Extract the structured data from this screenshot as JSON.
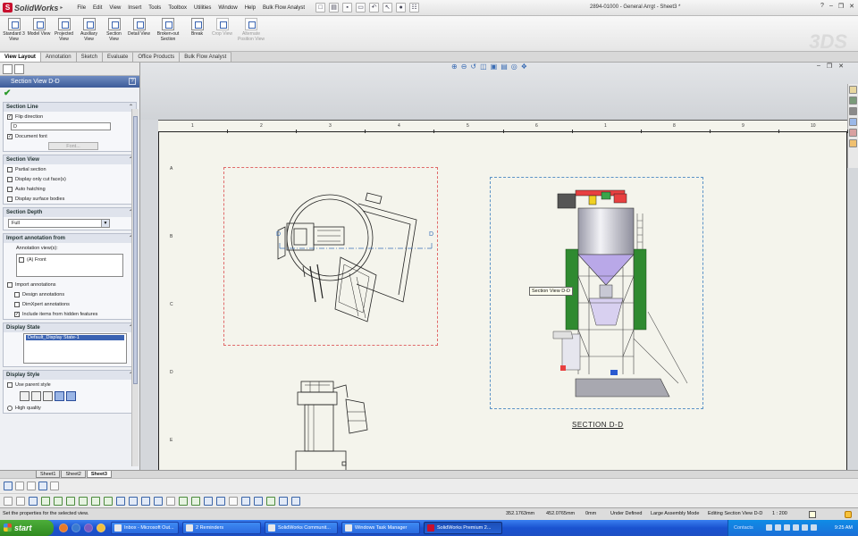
{
  "app": {
    "logo": "SolidWorks",
    "menu": [
      "File",
      "Edit",
      "View",
      "Insert",
      "Tools",
      "Toolbox",
      "Utilities",
      "Window",
      "Help",
      "Bulk Flow Analyst"
    ],
    "document_title": "2894-01000 - General Arrgt - Sheet3 *"
  },
  "command_manager": [
    {
      "label": "Standard 3 View",
      "icon": "standard-3-view-icon",
      "enabled": true
    },
    {
      "label": "Model View",
      "icon": "model-view-icon",
      "enabled": true
    },
    {
      "label": "Projected View",
      "icon": "projected-view-icon",
      "enabled": true
    },
    {
      "label": "Auxiliary View",
      "icon": "auxiliary-view-icon",
      "enabled": true
    },
    {
      "label": "Section View",
      "icon": "section-view-icon",
      "enabled": true
    },
    {
      "label": "Detail View",
      "icon": "detail-view-icon",
      "enabled": true
    },
    {
      "label": "Broken-out Section",
      "icon": "broken-out-section-icon",
      "enabled": true
    },
    {
      "label": "Break",
      "icon": "break-icon",
      "enabled": true
    },
    {
      "label": "Crop View",
      "icon": "crop-view-icon",
      "enabled": false
    },
    {
      "label": "Alternate Position View",
      "icon": "alternate-position-view-icon",
      "enabled": false
    }
  ],
  "tabs": [
    "View Layout",
    "Annotation",
    "Sketch",
    "Evaluate",
    "Office Products",
    "Bulk Flow Analyst"
  ],
  "active_tab": "View Layout",
  "property_manager": {
    "title": "Section View D-D",
    "section_line": {
      "header": "Section Line",
      "flip_direction": "Flip direction",
      "label_value": "D",
      "document_font": "Document font",
      "font_button": "Font..."
    },
    "section_view": {
      "header": "Section View",
      "options": [
        "Partial section",
        "Display only cut face(s)",
        "Auto hatching",
        "Display surface bodies"
      ]
    },
    "section_depth": {
      "header": "Section Depth",
      "value": "Full"
    },
    "import_annotation": {
      "header": "Import annotation from",
      "views_label": "Annotation view(s):",
      "view_item": "(A) Front",
      "import_annotations": "Import annotations",
      "design_annotations": "Design annotations",
      "dimxpert_annotations": "DimXpert annotations",
      "include_hidden": "Include items from hidden features"
    },
    "display_state": {
      "header": "Display State",
      "item": "Default_Display State-1"
    },
    "display_style": {
      "header": "Display Style",
      "use_parent": "Use parent style",
      "high_quality": "High quality"
    }
  },
  "drawing": {
    "ruler_numbers": [
      "1",
      "2",
      "3",
      "4",
      "5",
      "6",
      "1",
      "8",
      "9",
      "10"
    ],
    "zone_letters": [
      "A",
      "B",
      "C",
      "D",
      "E"
    ],
    "section_marker": "D",
    "tooltip": "Section View D-D",
    "section_label": "SECTION D-D"
  },
  "sheet_tabs": [
    "Sheet1",
    "Sheet2",
    "Sheet3"
  ],
  "active_sheet": "Sheet3",
  "status_bar": {
    "message": "Set the properties for the selected view.",
    "x": "352.1763mm",
    "y": "452.0765mm",
    "z": "0mm",
    "definition": "Under Defined",
    "mode": "Large Assembly Mode",
    "editing": "Editing Section View D-D",
    "scale": "1 : 200"
  },
  "taskbar": {
    "start": "start",
    "tasks": [
      {
        "label": "Inbox - Microsoft Out...",
        "active": false
      },
      {
        "label": "2 Reminders",
        "active": false
      },
      {
        "label": "SolidWorks Communit...",
        "active": false
      },
      {
        "label": "Windows Task Manager",
        "active": false
      },
      {
        "label": "SolidWorks Premium 2...",
        "active": true
      }
    ],
    "contacts": "Contacts",
    "clock": "9:25 AM"
  }
}
